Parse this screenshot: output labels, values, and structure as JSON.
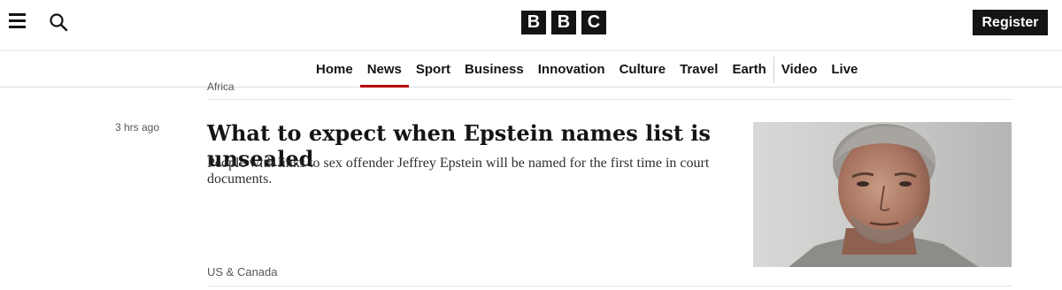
{
  "header": {
    "logo_letters": [
      "B",
      "B",
      "C"
    ],
    "register_label": "Register"
  },
  "nav": {
    "items": [
      {
        "label": "Home",
        "active": false
      },
      {
        "label": "News",
        "active": true
      },
      {
        "label": "Sport",
        "active": false
      },
      {
        "label": "Business",
        "active": false
      },
      {
        "label": "Innovation",
        "active": false
      },
      {
        "label": "Culture",
        "active": false
      },
      {
        "label": "Travel",
        "active": false
      },
      {
        "label": "Earth",
        "active": false
      },
      {
        "label": "Video",
        "active": false
      },
      {
        "label": "Live",
        "active": false
      }
    ],
    "accent_color": "#b80000"
  },
  "previous_article": {
    "topic": "Africa"
  },
  "article": {
    "timestamp": "3 hrs ago",
    "headline": "What to expect when Epstein names list is unsealed",
    "summary": "People with links to sex offender Jeffrey Epstein will be named for the first time in court documents.",
    "topic": "US & Canada"
  },
  "icons": {
    "menu": "menu-icon",
    "search": "search-icon"
  }
}
